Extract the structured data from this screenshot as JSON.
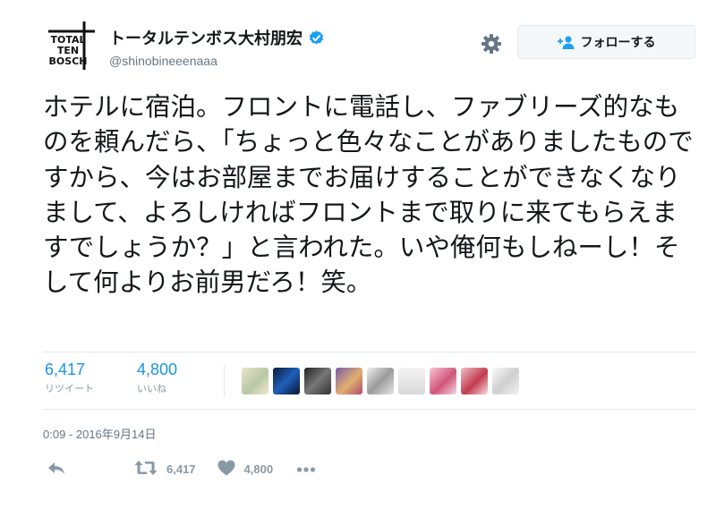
{
  "user": {
    "display_name": "トータルテンボス大村朋宏",
    "handle": "@shinobineeenaaa",
    "verified": true,
    "avatar_logo_text": "TOTAL TEN BOSCH"
  },
  "header": {
    "follow_label": "フォローする",
    "settings_icon": "gear-icon",
    "follow_icon": "add-user-icon"
  },
  "tweet": {
    "text": "ホテルに宿泊。フロントに電話し、ファブリーズ的なものを頼んだら、「ちょっと色々なことがありましたものですから、今はお部屋までお届けすることができなくなりまして、よろしければフロントまで取りに来てもらえますでしょうか？」と言われた。いや俺何もしねーし！そして何よりお前男だろ！笑。",
    "timestamp": "0:09 - 2016年9月14日"
  },
  "stats": {
    "retweets": {
      "value": "6,417",
      "label": "リツイート"
    },
    "likes": {
      "value": "4,800",
      "label": "いいね"
    }
  },
  "actions": {
    "reply_icon": "reply-icon",
    "retweet_icon": "retweet-icon",
    "retweet_count": "6,417",
    "like_icon": "heart-icon",
    "like_count": "4,800",
    "more_icon": "more-icon"
  },
  "colors": {
    "accent": "#1b95e0",
    "muted": "#8899a6",
    "text": "#14171a",
    "border": "#e1e8ed"
  }
}
